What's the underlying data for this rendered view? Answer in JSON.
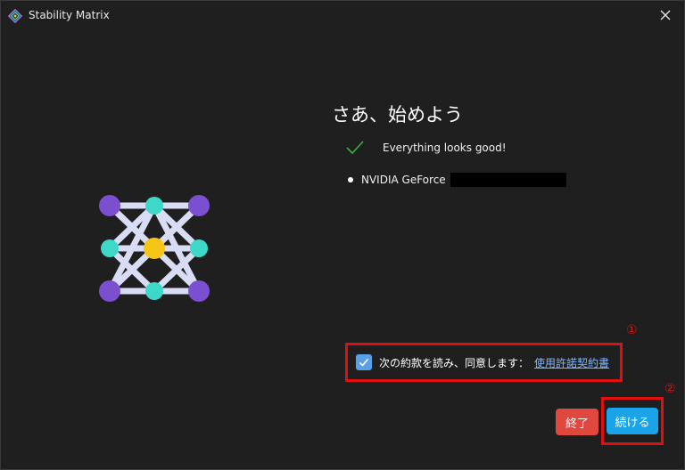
{
  "window": {
    "title": "Stability Matrix",
    "icon": "stability-matrix-logo-icon",
    "close_icon": "close-icon"
  },
  "welcome": {
    "heading": "さあ、始めよう",
    "status_text": "Everything looks good!",
    "gpu_label": "NVIDIA GeForce",
    "gpu_name_redacted": true
  },
  "agreement": {
    "checked": true,
    "text": "次の約款を読み、同意します：",
    "link_text": "使用許諾契約書"
  },
  "buttons": {
    "quit_label": "終了",
    "continue_label": "続ける"
  },
  "annotations": {
    "marker_1": "①",
    "marker_2": "②"
  },
  "colors": {
    "background": "#1f1f1f",
    "accent_blue": "#1aa3e8",
    "quit_red": "#e0473f",
    "annotation_red": "#e01010",
    "check_green": "#3cb043",
    "link_blue": "#7eb6ff"
  }
}
